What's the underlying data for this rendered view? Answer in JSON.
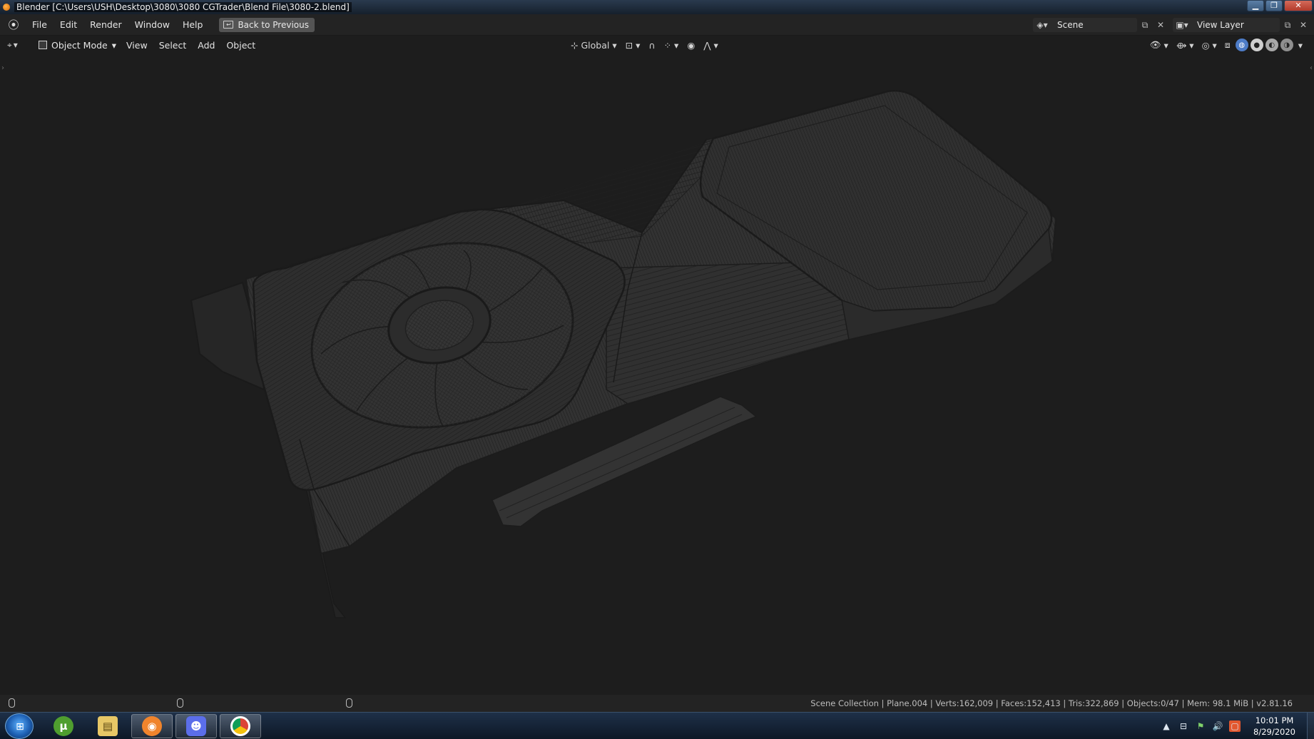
{
  "window": {
    "title": "Blender [C:\\Users\\USH\\Desktop\\3080\\3080 CGTrader\\Blend File\\3080-2.blend]",
    "controls": [
      "minimize-icon",
      "restore-icon",
      "close-icon"
    ]
  },
  "topbar": {
    "menus": [
      "File",
      "Edit",
      "Render",
      "Window",
      "Help"
    ],
    "back_button": "Back to Previous",
    "scene": "Scene",
    "view_layer": "View Layer"
  },
  "viewport_header": {
    "mode": "Object Mode",
    "menus": [
      "View",
      "Select",
      "Add",
      "Object"
    ],
    "transform_orientation": "Global",
    "shading_mode": "wireframe"
  },
  "statusbar": {
    "stats": "Scene Collection | Plane.004 | Verts:162,009 | Faces:152,413 | Tris:322,869 | Objects:0/47 | Mem: 98.1 MiB | v2.81.16"
  },
  "taskbar": {
    "apps": [
      "utorrent-icon",
      "file-explorer-icon",
      "blender-icon",
      "discord-icon",
      "chrome-icon"
    ],
    "time": "10:01 PM",
    "date": "8/29/2020"
  },
  "colors": {
    "viewport_bg": "#393939",
    "wire": "#1c1c1c",
    "header_bg": "#232323",
    "button_bg": "#545454"
  }
}
